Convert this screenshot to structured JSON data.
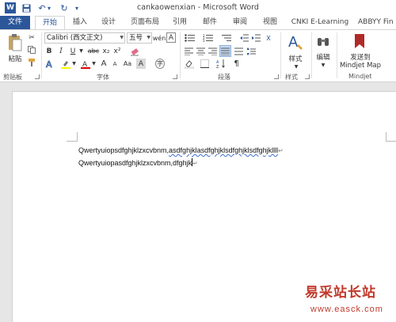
{
  "window": {
    "title": "cankaowenxian - Microsoft Word"
  },
  "quick_access": [
    {
      "name": "word-logo-icon",
      "glyph": "W"
    },
    {
      "name": "save-icon",
      "glyph": "💾"
    },
    {
      "name": "undo-icon",
      "glyph": "↶"
    },
    {
      "name": "undo-dropdown-icon",
      "glyph": "▾"
    },
    {
      "name": "redo-icon",
      "glyph": "↻"
    },
    {
      "name": "customize-qat-icon",
      "glyph": "▾"
    }
  ],
  "tabs": {
    "file": "文件",
    "home": "开始",
    "insert": "插入",
    "design": "设计",
    "layout": "页面布局",
    "references": "引用",
    "mailings": "邮件",
    "review": "审阅",
    "view": "视图",
    "cnki": "CNKI E-Learning",
    "abbyy": "ABBYY Fin"
  },
  "clipboard": {
    "paste": "粘贴",
    "group": "剪贴板"
  },
  "font": {
    "name": "Calibri (西文正文)",
    "size": "五号",
    "group": "字体",
    "bold": "B",
    "italic": "I",
    "underline": "U",
    "strike": "abc",
    "sub": "x₂",
    "sup": "x²",
    "grow": "A",
    "shrink": "A",
    "case": "Aa",
    "clear": "A",
    "wen": "wén",
    "charborder": "A"
  },
  "paragraph": {
    "group": "段落"
  },
  "styles": {
    "label": "样式",
    "group": "样式"
  },
  "editing": {
    "label": "编辑"
  },
  "mindjet": {
    "label_line1": "发送到",
    "label_line2": "Mindjet Map",
    "group": "Mindjet"
  },
  "document": {
    "line1_plain": "Qwertyuiopsdfghjklzxcvbnm,",
    "line1_squiggle": "asdfghjklasdfghjklsdfghjklsdfghjkllll",
    "line1_mark": "↵",
    "line2": "Qwertyuiopasdfghjklzxcvbnm,dfghjk",
    "line2_mark": "↵"
  },
  "watermark": {
    "cn": "易采站长站",
    "url": "www.easck.com"
  },
  "colors": {
    "accent": "#2b579a",
    "watermark": "#c0392b"
  }
}
